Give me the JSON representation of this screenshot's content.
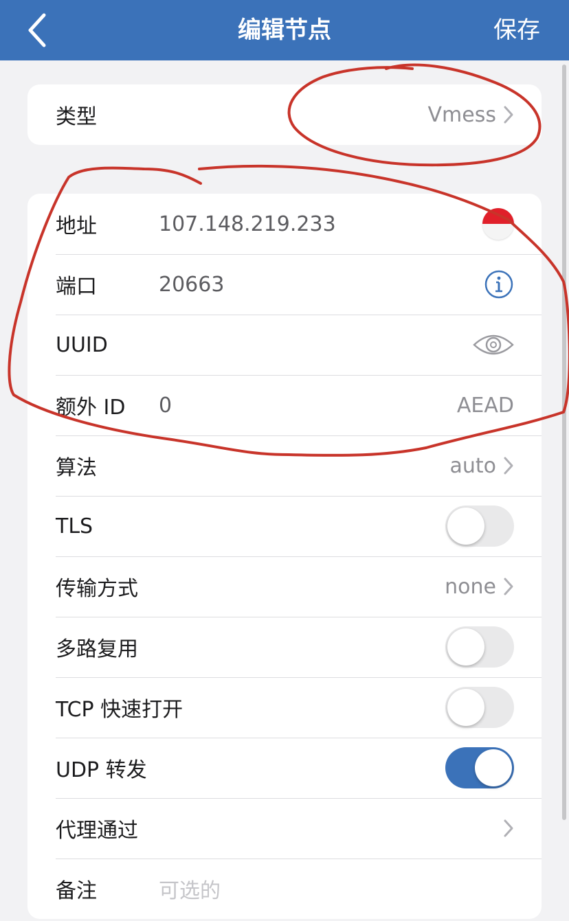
{
  "nav": {
    "back_icon": "chevron-left-icon",
    "title": "编辑节点",
    "save_label": "保存"
  },
  "type_row": {
    "label": "类型",
    "value": "Vmess"
  },
  "rows": {
    "address": {
      "label": "地址",
      "value": "107.148.219.233",
      "icon": "singapore-flag-icon"
    },
    "port": {
      "label": "端口",
      "value": "20663",
      "icon": "info-icon"
    },
    "uuid": {
      "label": "UUID",
      "value": "",
      "icon": "eye-icon"
    },
    "alter_id": {
      "label": "额外 ID",
      "value": "0",
      "right_text": "AEAD"
    },
    "cipher": {
      "label": "算法",
      "value": "auto"
    },
    "tls": {
      "label": "TLS",
      "on": false
    },
    "transport": {
      "label": "传输方式",
      "value": "none"
    },
    "mux": {
      "label": "多路复用",
      "on": false
    },
    "tcp_fast_open": {
      "label": "TCP 快速打开",
      "on": false
    },
    "udp_relay": {
      "label": "UDP 转发",
      "on": true
    },
    "proxy_via": {
      "label": "代理通过",
      "value": ""
    },
    "remark": {
      "label": "备注",
      "placeholder": "可选的"
    }
  },
  "colors": {
    "accent": "#3b72b9",
    "annotation": "#c8342a",
    "flag_red": "#e0202a"
  }
}
